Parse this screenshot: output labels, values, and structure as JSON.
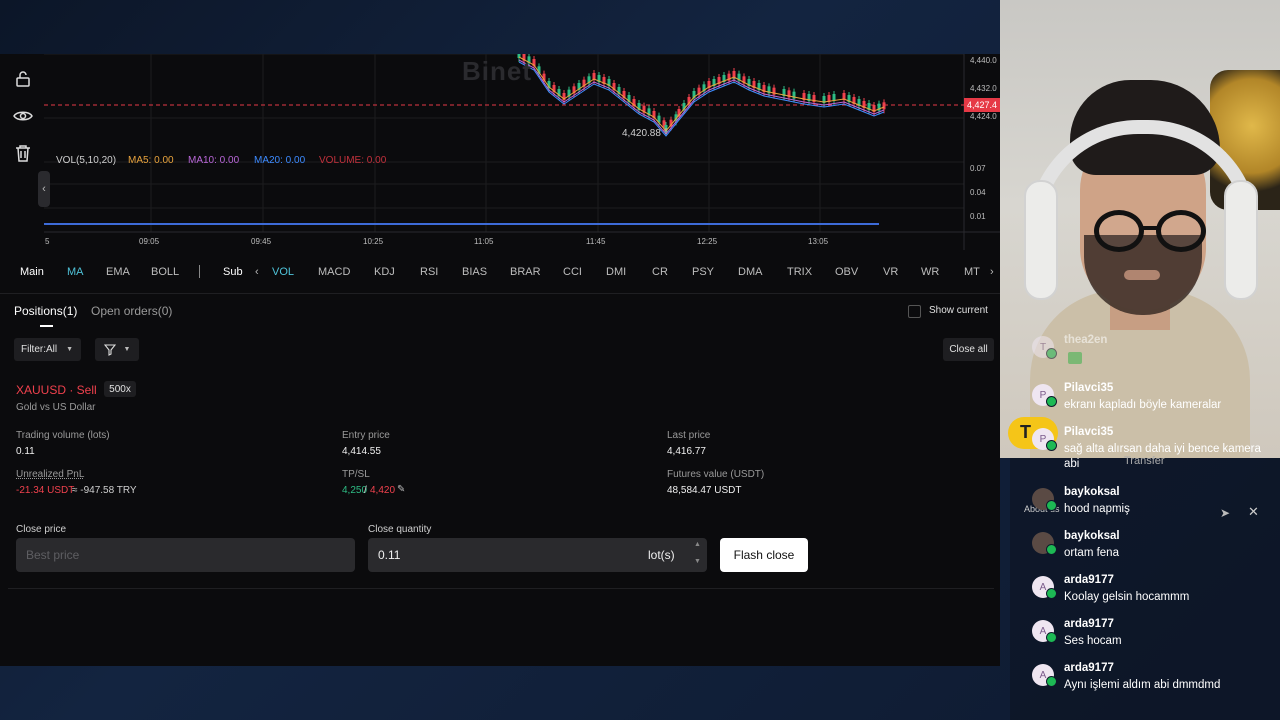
{
  "chart": {
    "price_ticks": [
      "4,440.0",
      "4,432.0",
      "4,424.0"
    ],
    "current_price_tag": "4,427.4",
    "low_label": "4,420.88",
    "vol_label": "VOL(5,10,20)",
    "ma5": "MA5: 0.00",
    "ma10": "MA10: 0.00",
    "ma20": "MA20: 0.00",
    "volume": "VOLUME: 0.00",
    "vol_ticks": [
      "0.07",
      "0.04",
      "0.01"
    ],
    "time_ticks": [
      "5",
      "09:05",
      "09:45",
      "10:25",
      "11:05",
      "11:45",
      "12:25",
      "13:05"
    ],
    "watermark": "Binet"
  },
  "indicators": {
    "main": "Main",
    "main_items": [
      "MA",
      "EMA",
      "BOLL"
    ],
    "sub": "Sub",
    "sub_items": [
      "VOL",
      "MACD",
      "KDJ",
      "RSI",
      "BIAS",
      "BRAR",
      "CCI",
      "DMI",
      "CR",
      "PSY",
      "DMA",
      "TRIX",
      "OBV",
      "VR",
      "WR",
      "MT"
    ]
  },
  "positions": {
    "tab_positions": "Positions(1)",
    "tab_orders": "Open orders(0)",
    "show_current": "Show current",
    "filter": "Filter:All",
    "close_all": "Close all",
    "symbol": "XAUUSD · Sell",
    "leverage": "500x",
    "subtitle": "Gold vs US Dollar",
    "trading_volume_label": "Trading volume (lots)",
    "trading_volume": "0.11",
    "entry_price_label": "Entry price",
    "entry_price": "4,414.55",
    "last_price_label": "Last price",
    "last_price": "4,416.77",
    "pnl_label": "Unrealized PnL",
    "pnl_usdt": "-21.34 USDT",
    "pnl_try": "≈ -947.58 TRY",
    "tpsl_label": "TP/SL",
    "tp": "4,250",
    "sl": "4,420",
    "futures_label": "Futures value (USDT)",
    "futures_value": "48,584.47 USDT",
    "close_price_label": "Close price",
    "close_price_placeholder": "Best price",
    "close_qty_label": "Close quantity",
    "close_qty": "0.11",
    "unit": "lot(s)",
    "flash_close": "Flash close"
  },
  "chat": [
    {
      "user": "thea2en",
      "text": "",
      "initial": "T"
    },
    {
      "user": "Pilavci35",
      "text": "ekranı kapladı böyle kameralar",
      "initial": "P"
    },
    {
      "user": "Pilavci35",
      "text": "sağ alta alırsan daha iyi bence kamera abi",
      "initial": "P"
    },
    {
      "user": "baykoksal",
      "text": "hood napmiş",
      "initial": ""
    },
    {
      "user": "baykoksal",
      "text": "ortam fena",
      "initial": ""
    },
    {
      "user": "arda9177",
      "text": "Koolay gelsin hocammm",
      "initial": "A"
    },
    {
      "user": "arda9177",
      "text": "Ses hocam",
      "initial": "A"
    },
    {
      "user": "arda9177",
      "text": "Aynı işlemi aldım abi dmmdmd",
      "initial": "A"
    }
  ],
  "bg_fragments": {
    "transfer": "Transfer",
    "about": "About us",
    "t": "T"
  },
  "colors": {
    "accent_cyan": "#4fc3d9",
    "sell_red": "#f0414d",
    "buy_green": "#2ebd85",
    "ma5": "#e8a33d",
    "ma10": "#b967d8",
    "ma20": "#3d8bff"
  }
}
